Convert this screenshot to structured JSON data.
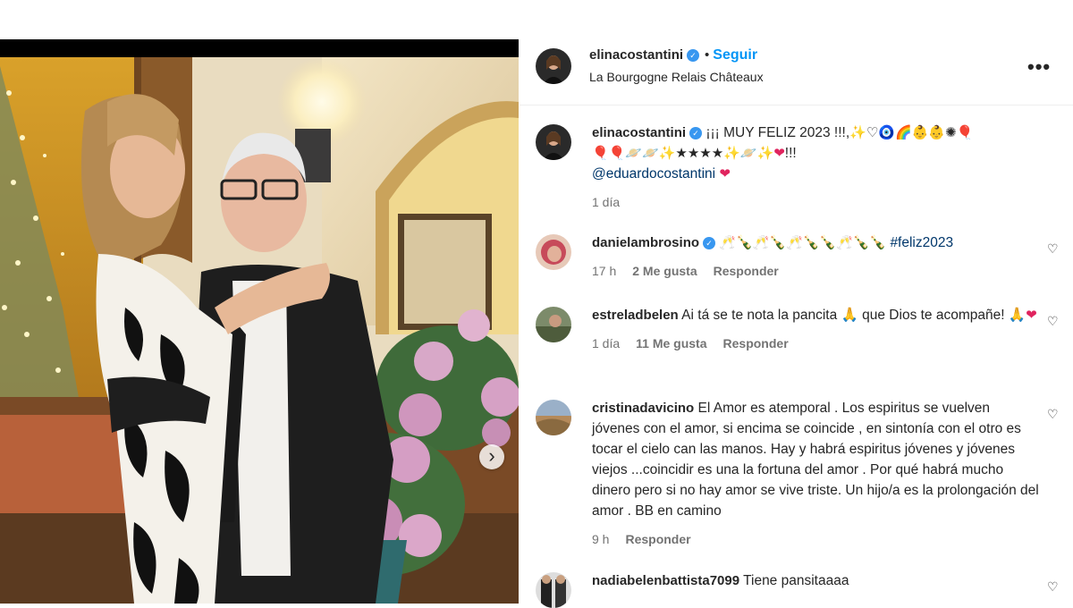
{
  "post": {
    "author": "elinacostantini",
    "follow_label": "Seguir",
    "location": "La Bourgogne Relais Châteaux",
    "verified_glyph": "✓",
    "separator": "•",
    "more_glyph": "•••",
    "carousel_next_glyph": "›"
  },
  "caption": {
    "author": "elinacostantini",
    "text": "¡¡¡ MUY FELIZ 2023 !!!,",
    "emoji_line1": "✨♡🧿🌈👶👶✺🎈",
    "emoji_line2": "🎈🎈🪐🪐✨★★★★✨🪐✨",
    "emoji_line2_end": "!!!",
    "heart": "❤",
    "mention": "@eduardocostantini",
    "time": "1 día"
  },
  "comments": [
    {
      "user": "danielambrosino",
      "verified": true,
      "text_emoji": "🥂🍾🥂🍾🥂🍾🍾🥂🍾🍾",
      "hashtag": "#feliz2023",
      "time": "17 h",
      "likes": "2 Me gusta",
      "reply": "Responder"
    },
    {
      "user": "estreladbelen",
      "text": "Ai tá se te nota la pancita 🙏 que Dios te acompañe! 🙏",
      "heart": "❤",
      "time": "1 día",
      "likes": "11 Me gusta",
      "reply": "Responder"
    },
    {
      "user": "cristinadavicino",
      "text": "El Amor es atemporal . Los espiritus se vuelven jóvenes con el amor, si encima se coincide , en sintonía con el otro es tocar el cielo can las manos. Hay y habrá espiritus jóvenes y jóvenes viejos ...coincidir es una la fortuna del amor . Por qué habrá mucho dinero pero si no hay amor se vive triste. Un hijo/a es la prolongación del amor . BB en camino",
      "time": "9 h",
      "reply": "Responder"
    },
    {
      "user": "nadiabelenbattista7099",
      "text": "Tiene pansitaaaa"
    }
  ],
  "like_icon_glyph": "♡",
  "colors": {
    "link_blue": "#0095f6",
    "text": "#262626",
    "muted": "#737373",
    "verified": "#3897f0"
  }
}
